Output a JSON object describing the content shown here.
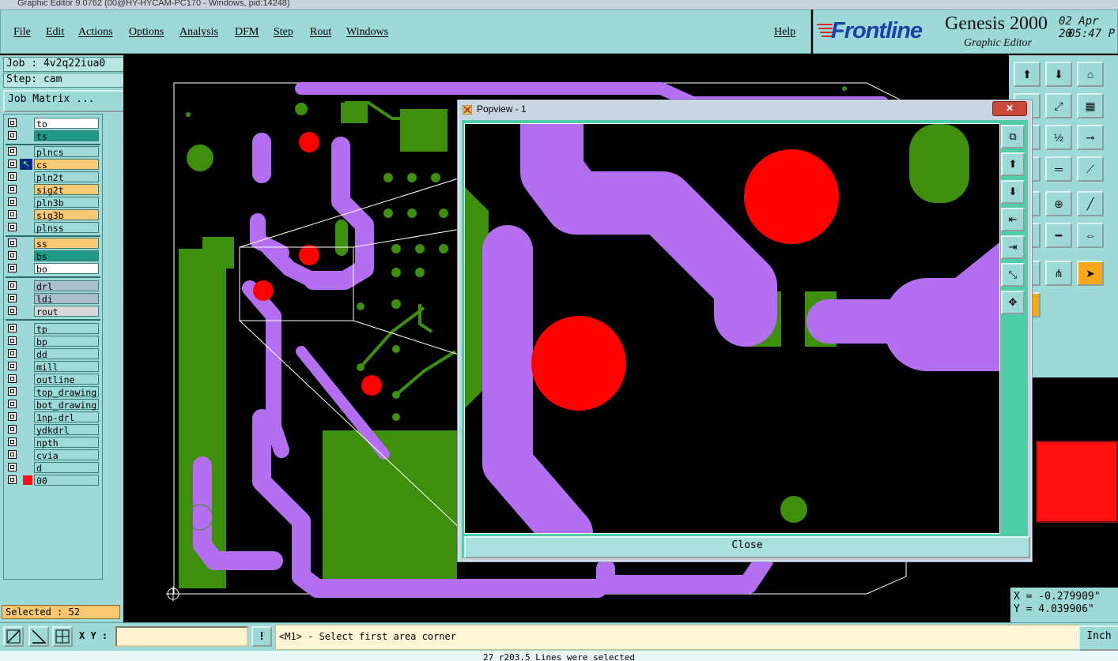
{
  "window": {
    "title": "Graphic Editor 9.0762 (00@HY-HYCAM-PC170 - Windows, pid:14248)"
  },
  "menu": {
    "file": "File",
    "edit": "Edit",
    "actions": "Actions",
    "options": "Options",
    "analysis": "Analysis",
    "dfm": "DFM",
    "step": "Step",
    "rout": "Rout",
    "windows": "Windows",
    "help": "Help"
  },
  "brand": {
    "logo": "Frontline",
    "product": "Genesis 2000",
    "subtitle": "Graphic Editor",
    "date": "02 Apr 20",
    "time": "05:47 P"
  },
  "job": {
    "job_label": "Job : 4v2q22iua0",
    "step_label": "Step: cam",
    "matrix_button": "Job Matrix ..."
  },
  "layers": [
    {
      "name": "to"
    },
    {
      "name": "ts"
    },
    {
      "name": "plncs"
    },
    {
      "name": "cs"
    },
    {
      "name": "pln2t"
    },
    {
      "name": "sig2t"
    },
    {
      "name": "pln3b"
    },
    {
      "name": "sig3b"
    },
    {
      "name": "plnss"
    },
    {
      "name": "ss"
    },
    {
      "name": "bs"
    },
    {
      "name": "bo"
    },
    {
      "name": "drl"
    },
    {
      "name": "ldi"
    },
    {
      "name": "rout"
    },
    {
      "name": "tp"
    },
    {
      "name": "bp"
    },
    {
      "name": "dd"
    },
    {
      "name": "mill"
    },
    {
      "name": "outline"
    },
    {
      "name": "top_drawing"
    },
    {
      "name": "bot_drawing"
    },
    {
      "name": "1np-drl"
    },
    {
      "name": "ydkdrl"
    },
    {
      "name": "npth"
    },
    {
      "name": "cvia"
    },
    {
      "name": "d"
    },
    {
      "name": "00"
    }
  ],
  "colors": {
    "panel": "#9dd9d6",
    "trace": "#b36ff0",
    "copper": "#3f8f0e",
    "pad": "#ff0000",
    "selected_layer": "#f9c870",
    "board_layer": "#1e9a86"
  },
  "popview": {
    "title": "Popview - 1",
    "close_label": "Close"
  },
  "coords": {
    "x": "X = -0.279909\"",
    "y": "Y = 4.039906\""
  },
  "status": {
    "selected": "Selected : 52",
    "xy_label": "X Y :",
    "xy_value": "",
    "message": "<M1> - Select first area corner",
    "units": "Inch",
    "bottom_line": "27 r203.5 Lines were selected"
  }
}
